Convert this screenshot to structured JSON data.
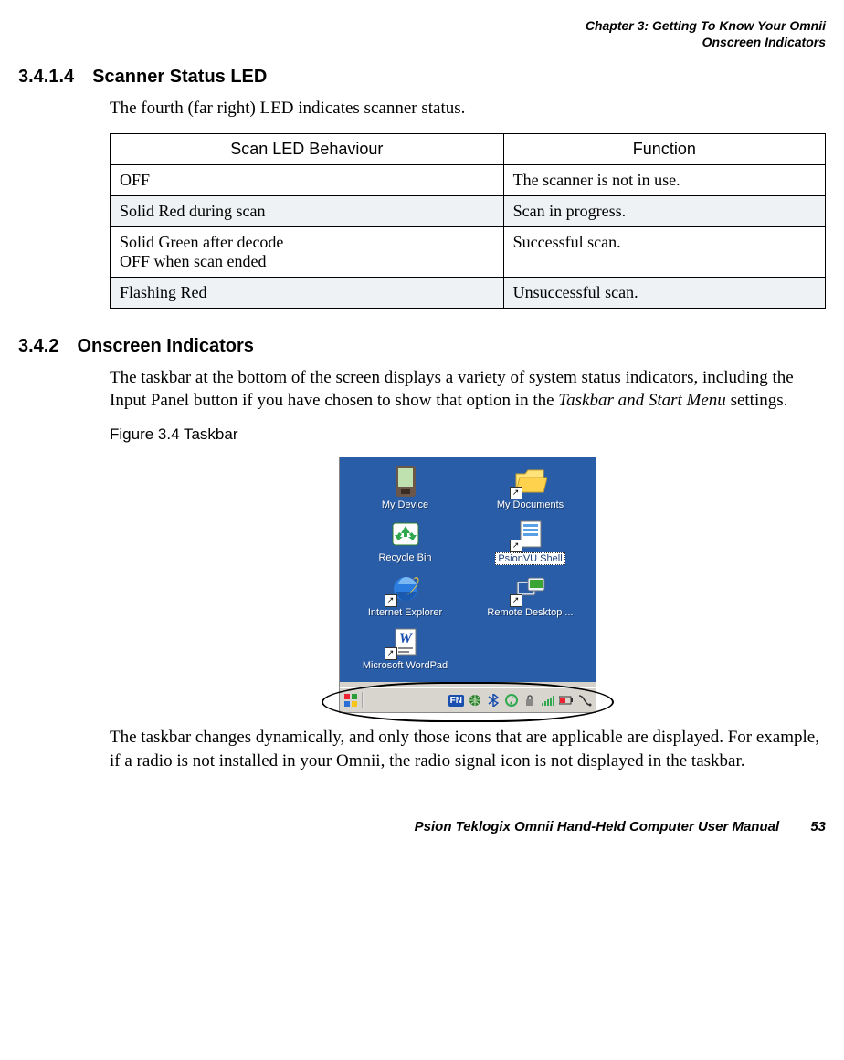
{
  "header": {
    "line1": "Chapter 3: Getting To Know Your Omnii",
    "line2": "Onscreen Indicators"
  },
  "sec1": {
    "num": "3.4.1.4",
    "title": "Scanner Status LED",
    "intro": "The fourth (far right) LED indicates scanner status."
  },
  "table": {
    "h1": "Scan LED Behaviour",
    "h2": "Function",
    "rows": [
      {
        "a": "OFF",
        "b": "The scanner is not in use."
      },
      {
        "a": "Solid Red during scan",
        "b": "Scan in progress."
      },
      {
        "a": "Solid Green after decode\nOFF when scan ended",
        "b": "Successful scan."
      },
      {
        "a": "Flashing Red",
        "b": "Unsuccessful scan."
      }
    ]
  },
  "sec2": {
    "num": "3.4.2",
    "title": "Onscreen Indicators",
    "para_a": "The taskbar at the bottom of the screen displays a variety of system status indicators, including the Input Panel button if you have chosen to show that option in the ",
    "para_ital": "Taskbar and Start Menu",
    "para_b": " settings.",
    "fig_label": "Figure 3.4  Taskbar",
    "para2": "The taskbar changes dynamically, and only those icons that are applicable are displayed. For example, if a radio is not installed in your Omnii, the radio signal icon is not displayed in the taskbar."
  },
  "desktop": {
    "icons": [
      {
        "label": "My Device"
      },
      {
        "label": "My Documents"
      },
      {
        "label": "Recycle Bin"
      },
      {
        "label": "PsionVU Shell",
        "selected": true
      },
      {
        "label": "Internet Explorer"
      },
      {
        "label": "Remote Desktop ..."
      },
      {
        "label": "Microsoft WordPad"
      }
    ],
    "taskbar_fn": "FN"
  },
  "footer": {
    "text": "Psion Teklogix Omnii Hand-Held Computer User Manual",
    "page": "53"
  }
}
